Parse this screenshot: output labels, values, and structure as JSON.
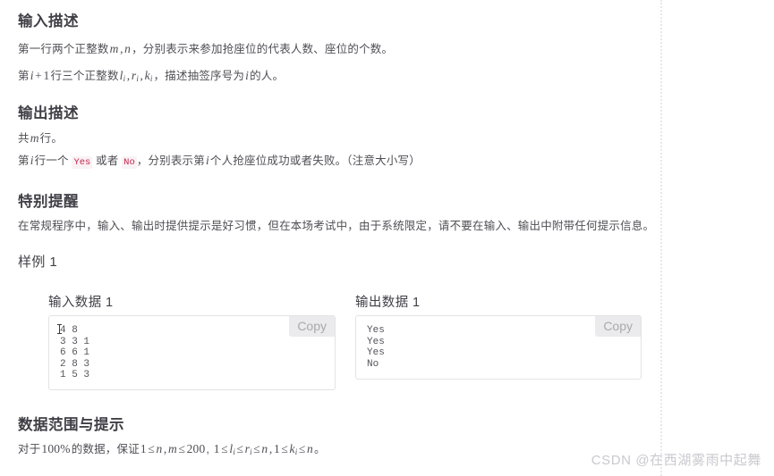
{
  "sections": {
    "input_desc": {
      "title": "输入描述",
      "line1": {
        "pre": "第一行两个正整数",
        "math": "m, n",
        "post": "，分别表示来参加抢座位的代表人数、座位的个数。"
      },
      "line2": {
        "pre": "第",
        "math1": "i + 1",
        "mid": "行三个正整数",
        "math2": "l_i, r_i, k_i",
        "post1": "，描述抽签序号为",
        "math3": "i",
        "post2": "的人。"
      }
    },
    "output_desc": {
      "title": "输出描述",
      "line1": {
        "pre": "共",
        "math": "m",
        "post": "行。"
      },
      "line2": {
        "pre": "第",
        "math1": "i",
        "mid": "行一个",
        "code_yes": "Yes",
        "or": "或者",
        "code_no": "No",
        "post1": "，分别表示第",
        "math2": "i",
        "post2": "个人抢座位成功或者失败。（注意大小写）"
      }
    },
    "special_note": {
      "title": "特别提醒",
      "text": "在常规程序中，输入、输出时提供提示是好习惯，但在本场考试中，由于系统限定，请不要在输入、输出中附带任何提示信息。"
    },
    "sample": {
      "title": "样例 1",
      "input_box": {
        "title": "输入数据 1",
        "copy_label": "Copy",
        "content": "4 8\n3 3 1\n6 6 1\n2 8 3\n1 5 3"
      },
      "output_box": {
        "title": "输出数据 1",
        "copy_label": "Copy",
        "content": "Yes\nYes\nYes\nNo"
      }
    },
    "constraints": {
      "title": "数据范围与提示",
      "line": {
        "pre": "对于",
        "math_pct": "100%",
        "mid": "的数据，保证",
        "math1": "1 ≤ n, m ≤ 200",
        "sep": ",",
        "math2": "1 ≤ l_i ≤ r_i ≤ n, 1 ≤ k_i ≤ n",
        "post": "。"
      }
    }
  },
  "watermark": "CSDN @在西湖雾雨中起舞",
  "colors": {
    "code_chip_text": "#c7254e",
    "code_chip_bg": "#f9f2f4",
    "heading": "#3f3f46",
    "body_text": "#4f4f55",
    "box_border": "#e3e3e6",
    "copy_bg": "#ebebed",
    "watermark": "#c9c9cf",
    "dotted_rule": "#e8e8ec"
  }
}
